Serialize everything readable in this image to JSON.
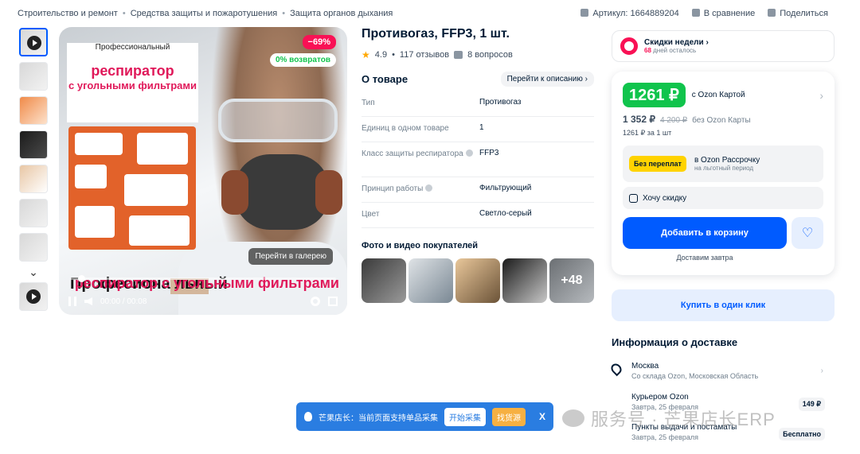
{
  "breadcrumb": [
    "Строительство и ремонт",
    "Средства защиты и пожаротушения",
    "Защита органов дыхания"
  ],
  "top_actions": {
    "article": "Артикул: 1664889204",
    "compare": "В сравнение",
    "share": "Поделиться"
  },
  "media": {
    "discount": "−69%",
    "returns": "0% возвратов",
    "gallery_link": "Перейти в галерею",
    "sign_top": "Профессиональный",
    "sign_main": "респиратор",
    "sign_sub": "с угольными фильтрами",
    "overlay_left": "Професиона льный",
    "overlay_right": "респиратор с угольными фильтрами",
    "time": "00:00 / 00:08",
    "progress": 0.03
  },
  "product": {
    "title": "Противогаз, FFP3, 1 шт.",
    "rating": "4.9",
    "reviews": "117 отзывов",
    "questions": "8 вопросов"
  },
  "about": {
    "title": "О товаре",
    "link": "Перейти к описанию",
    "specs": [
      {
        "k": "Тип",
        "v": "Противогаз",
        "info": false
      },
      {
        "k": "Единиц в одном товаре",
        "v": "1",
        "info": false
      },
      {
        "k": "Класс защиты респиратора",
        "v": "FFP3",
        "info": true
      },
      {
        "k": "Принцип работы",
        "v": "Фильтрующий",
        "info": true
      },
      {
        "k": "Цвет",
        "v": "Светло-серый",
        "info": false
      }
    ]
  },
  "photos": {
    "title": "Фото и видео покупателей",
    "more": "+48"
  },
  "deals": {
    "title": "Скидки недели",
    "left_count": "68",
    "left_label": "дней осталось"
  },
  "pricing": {
    "card_price": "1261 ₽",
    "card_label": "с Ozon Картой",
    "price": "1 352 ₽",
    "old_price": "4 200 ₽",
    "without_card": "без Ozon Карты",
    "unit_price": "1261 ₽ за 1 шт",
    "installment_badge": "Без переплат",
    "installment_title": "в Ozon Рассрочку",
    "installment_sub": "на льготный период",
    "want_discount": "Хочу скидку",
    "add_to_cart": "Добавить в корзину",
    "delivery_note": "Доставим завтра",
    "one_click": "Купить в один клик"
  },
  "delivery": {
    "title": "Информация о доставке",
    "city": "Москва",
    "city_sub": "Со склада Ozon, Московская Область",
    "courier": "Курьером Ozon",
    "courier_date": "Завтра, 25 февраля",
    "courier_price": "149 ₽",
    "pickup": "Пункты выдачи и постаматы",
    "pickup_date": "Завтра, 25 февраля",
    "pickup_price": "Бесплатно"
  },
  "plugin": {
    "text": "芒果店长：当前页面支持单品采集",
    "start": "开始采集",
    "find_source": "找货源",
    "close": "X"
  },
  "watermark": "服务号 · 芒果店长ERP",
  "colors": {
    "accent_blue": "#005bff",
    "ozon_green": "#10c44c",
    "discount_red": "#f91155",
    "installment_yellow": "#ffd300"
  }
}
